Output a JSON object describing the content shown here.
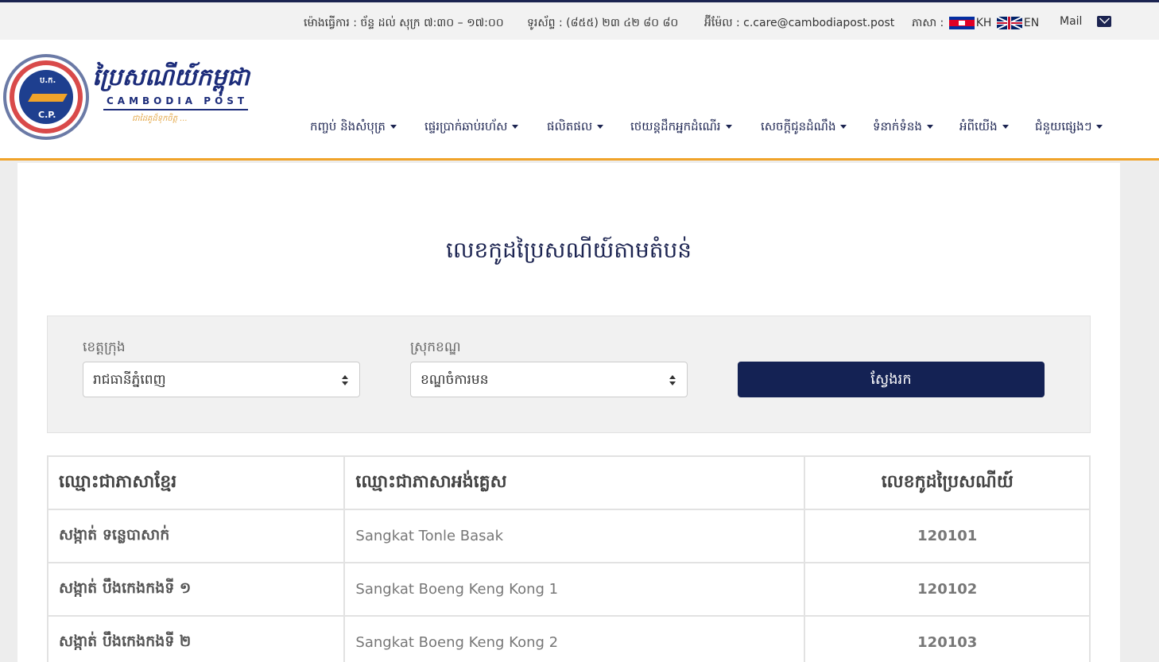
{
  "topbar": {
    "hours": "ម៉ោងធ្វើការ : ច័ន្ទ ដល់ សុក្រ ៧:៣០ – ១៧:០០",
    "phone": "ទូរស័ព្ទ : (៨៥៥) ២៣ ៤២ ៨០ ៨០",
    "email": "អ៊ីម៉ែល : c.care@cambodiapost.post",
    "language_label": "ភាសា :",
    "lang_kh": "KH",
    "lang_en": "EN",
    "mail_label": "Mail"
  },
  "logo": {
    "kh_text": "ប្រៃសណីយ៍កម្ពុជា",
    "en_text": "CAMBODIA POST",
    "slogan": "ជាដៃគូដ៏ទុកចិត្ត ...",
    "emblem_top": "ប.ក.",
    "emblem_bottom": "C.P."
  },
  "nav": {
    "items": [
      {
        "label": "កញ្ចប់ និងសំបុត្រ"
      },
      {
        "label": "ផ្ទេរប្រាក់ឆាប់រហ័ស"
      },
      {
        "label": "ផលិតផល"
      },
      {
        "label": "ថេយន្តដឹកអ្នកដំណើរ"
      },
      {
        "label": "សេចក្តីជូនដំណឹង"
      },
      {
        "label": "ទំនាក់ទំនង"
      },
      {
        "label": "អំពីយើង"
      },
      {
        "label": "ជំនួយផ្សេងៗ"
      }
    ]
  },
  "page": {
    "title": "លេខកូដប្រៃសណីយ៍តាមតំបន់"
  },
  "filter": {
    "province_label": "ខេត្តក្រុង",
    "province_value": "រាជធានីភ្នំពេញ",
    "district_label": "ស្រុកខណ្ឌ",
    "district_value": "ខណ្ឌចំការមន",
    "search_label": "ស្វែងរក"
  },
  "table": {
    "headers": [
      "ឈ្មោះជាភាសាខ្មែរ",
      "ឈ្មោះជាភាសាអង់គ្លេស",
      "លេខកូដប្រៃសណីយ៍"
    ],
    "rows": [
      {
        "kh": "សង្កាត់ ទន្លេបាសាក់",
        "en": "Sangkat Tonle Basak",
        "code": "120101"
      },
      {
        "kh": "សង្កាត់ បឹងកេងកងទី ១",
        "en": "Sangkat Boeng Keng Kong 1",
        "code": "120102"
      },
      {
        "kh": "សង្កាត់ បឹងកេងកងទី ២",
        "en": "Sangkat Boeng Keng Kong 2",
        "code": "120103"
      }
    ]
  },
  "colors": {
    "navy": "#142254",
    "accent_orange": "#f0a32a",
    "background": "#ededed"
  }
}
